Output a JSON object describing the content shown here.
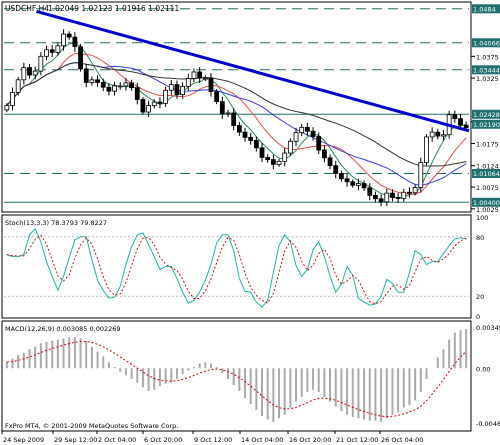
{
  "chart_data": {
    "type": "candlestick",
    "symbol": "USDCHF,H4",
    "ohlc_label": "1.02049 1.02123 1.01916 1.02111",
    "copyright": "FxPro MT4, © 2001-2009 MetaQuotes Software Corp.",
    "x_labels": [
      "24 Sep 2009",
      "29 Sep 12:00",
      "2 Oct 04:00",
      "6 Oct 20:00",
      "9 Oct 12:00",
      "14 Oct 04:00",
      "16 Oct 20:00",
      "21 Oct 12:00",
      "26 Oct 04:00"
    ],
    "price_axis": {
      "ylim": [
        1.002,
        1.0495
      ],
      "tick_labels": [
        1.0375,
        1.0325,
        1.0225,
        1.0175,
        1.0124,
        1.0075,
        1.0025
      ],
      "level_labels": [
        {
          "value": 1.0484,
          "label": "1.0484"
        },
        {
          "value": 1.0406,
          "label": "1.04066"
        },
        {
          "value": 1.0344,
          "label": "1.03444"
        },
        {
          "value": 1.0242,
          "label": "1.02428"
        },
        {
          "value": 1.0219,
          "label": "1.02190"
        },
        {
          "value": 1.0106,
          "label": "1.01064"
        },
        {
          "value": 1.004,
          "label": "1.00400"
        }
      ]
    },
    "horizontal_levels": [
      1.0484,
      1.0406,
      1.0344,
      1.0242,
      1.0106,
      1.004
    ],
    "trendline": {
      "from": [
        0.07,
        1.0478
      ],
      "to": [
        1.0,
        1.0204
      ]
    },
    "closes": [
      1.0262,
      1.0292,
      1.0321,
      1.0349,
      1.0332,
      1.0341,
      1.0375,
      1.039,
      1.0384,
      1.0399,
      1.0426,
      1.0419,
      1.0397,
      1.0346,
      1.0315,
      1.0321,
      1.0315,
      1.0304,
      1.0295,
      1.0307,
      1.0307,
      1.0314,
      1.0303,
      1.0276,
      1.0247,
      1.0262,
      1.027,
      1.0267,
      1.0297,
      1.031,
      1.0287,
      1.0306,
      1.0324,
      1.0339,
      1.0325,
      1.0325,
      1.0294,
      1.0271,
      1.0243,
      1.0245,
      1.0216,
      1.0201,
      1.0189,
      1.0182,
      1.0165,
      1.0143,
      1.0138,
      1.0127,
      1.0134,
      1.0153,
      1.018,
      1.02,
      1.0212,
      1.0203,
      1.0191,
      1.016,
      1.0142,
      1.0124,
      1.0106,
      1.0094,
      1.0087,
      1.0079,
      1.0083,
      1.0073,
      1.0056,
      1.0048,
      1.0041,
      1.0061,
      1.0051,
      1.0049,
      1.0063,
      1.0062,
      1.0074,
      1.0131,
      1.019,
      1.0201,
      1.0192,
      1.0195,
      1.0241,
      1.0232,
      1.0217,
      1.0211
    ],
    "moving_averages": [
      {
        "name": "MA fast",
        "color": "#2e8b57"
      },
      {
        "name": "MA mid",
        "color": "#d9534f"
      },
      {
        "name": "MA slow",
        "color": "#3b3bd9"
      },
      {
        "name": "MA long",
        "color": "#333333"
      }
    ],
    "stoch": {
      "label": "Stoch(13,3,3) 78.3793 79.8227",
      "ylim": [
        0,
        100
      ],
      "tick_labels": [
        100,
        80,
        20,
        0
      ],
      "values": [
        62,
        60,
        60,
        62,
        82,
        88,
        75,
        55,
        40,
        26,
        40,
        59,
        77,
        80,
        80,
        57,
        36,
        26,
        18,
        19,
        30,
        52,
        70,
        82,
        84,
        72,
        60,
        47,
        50,
        50,
        38,
        24,
        13,
        16,
        24,
        36,
        52,
        74,
        82,
        82,
        66,
        38,
        25,
        24,
        14,
        9,
        16,
        44,
        71,
        82,
        75,
        51,
        40,
        47,
        67,
        75,
        60,
        40,
        24,
        32,
        50,
        41,
        18,
        14,
        11,
        12,
        20,
        37,
        33,
        24,
        24,
        44,
        66,
        62,
        52,
        55,
        55,
        63,
        71,
        78,
        79,
        78
      ],
      "signal_color": "#c00000",
      "main_color": "#20b2aa"
    },
    "macd": {
      "label": "MACD(12,26,9) 0.003085 0.002269",
      "tick_labels": [
        "0.00345",
        "0.00",
        "-0.00461"
      ],
      "ylim": [
        -0.0051,
        0.0038
      ],
      "hist": [
        0.0005,
        0.0008,
        0.0011,
        0.0013,
        0.0016,
        0.0018,
        0.0021,
        0.0022,
        0.0023,
        0.0024,
        0.0025,
        0.0026,
        0.0026,
        0.0025,
        0.0023,
        0.0018,
        0.0014,
        0.001,
        0.0005,
        0.0001,
        -0.0003,
        -0.0006,
        -0.0009,
        -0.0012,
        -0.0016,
        -0.0019,
        -0.0018,
        -0.0015,
        -0.0013,
        -0.0012,
        -0.0009,
        -0.0005,
        -0.0002,
        0.0001,
        0.0004,
        0.0005,
        0.0004,
        0.0001,
        -0.0004,
        -0.0009,
        -0.0014,
        -0.0019,
        -0.0025,
        -0.003,
        -0.0035,
        -0.004,
        -0.0043,
        -0.0045,
        -0.0042,
        -0.0039,
        -0.0033,
        -0.0028,
        -0.0024,
        -0.002,
        -0.0018,
        -0.002,
        -0.0024,
        -0.0028,
        -0.0032,
        -0.0036,
        -0.0039,
        -0.0041,
        -0.0042,
        -0.0043,
        -0.0044,
        -0.0044,
        -0.0045,
        -0.0042,
        -0.0039,
        -0.0037,
        -0.0033,
        -0.0031,
        -0.0027,
        -0.002,
        -0.0009,
        0.0,
        0.0009,
        0.0016,
        0.0024,
        0.003,
        0.0032,
        0.0033
      ],
      "hist_color": "#a9a9a9",
      "signal_color": "#d00000"
    }
  }
}
